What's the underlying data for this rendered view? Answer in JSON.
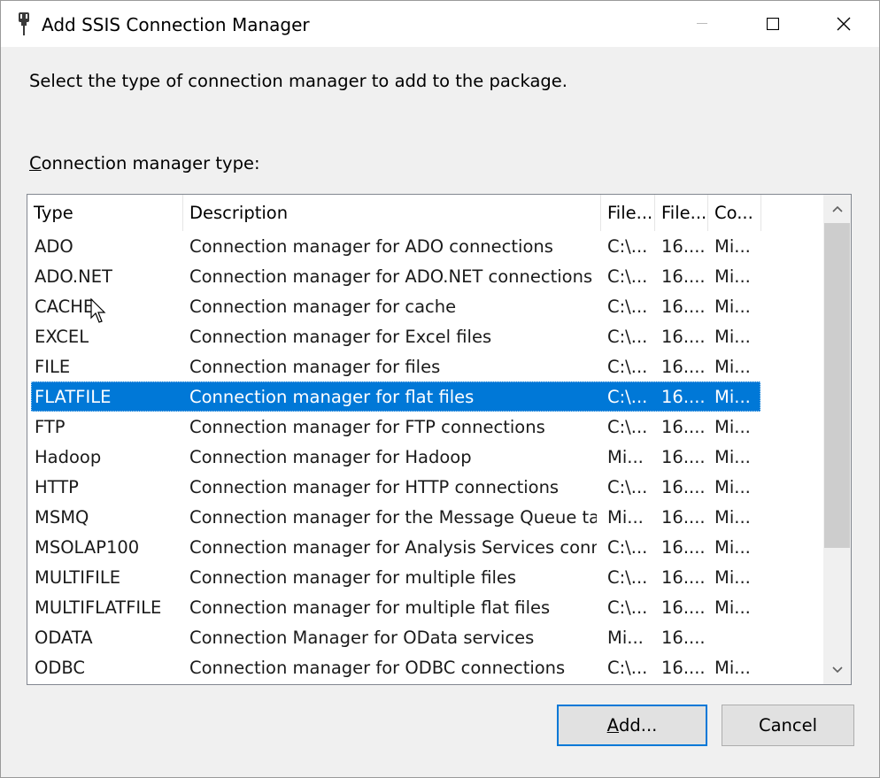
{
  "window": {
    "title": "Add SSIS Connection Manager",
    "app_icon": "ssis-plug-icon",
    "controls": [
      "minimize-icon",
      "maximize-icon",
      "close-icon"
    ]
  },
  "instruction": "Select the type of connection manager to add to the package.",
  "list_label": {
    "accel": "C",
    "rest": "onnection manager type:"
  },
  "columns": [
    "Type",
    "Description",
    "File...",
    "File...",
    "Co..."
  ],
  "rows": [
    {
      "type": "ADO",
      "description": "Connection manager for ADO connections",
      "file_name": "C:\\...",
      "file_version": "16....",
      "company": "Mi..."
    },
    {
      "type": "ADO.NET",
      "description": "Connection manager for ADO.NET connections",
      "file_name": "C:\\...",
      "file_version": "16....",
      "company": "Mi..."
    },
    {
      "type": "CACHE",
      "description": "Connection manager for cache",
      "file_name": "C:\\...",
      "file_version": "16....",
      "company": "Mi..."
    },
    {
      "type": "EXCEL",
      "description": "Connection manager for Excel files",
      "file_name": "C:\\...",
      "file_version": "16....",
      "company": "Mi..."
    },
    {
      "type": "FILE",
      "description": "Connection manager for files",
      "file_name": "C:\\...",
      "file_version": "16....",
      "company": "Mi..."
    },
    {
      "type": "FLATFILE",
      "description": "Connection manager for flat files",
      "file_name": "C:\\...",
      "file_version": "16....",
      "company": "Mi...",
      "selected": true
    },
    {
      "type": "FTP",
      "description": "Connection manager for FTP connections",
      "file_name": "C:\\...",
      "file_version": "16....",
      "company": "Mi..."
    },
    {
      "type": "Hadoop",
      "description": "Connection manager for Hadoop",
      "file_name": "Mi...",
      "file_version": "16....",
      "company": "Mi..."
    },
    {
      "type": "HTTP",
      "description": "Connection manager for HTTP connections",
      "file_name": "C:\\...",
      "file_version": "16....",
      "company": "Mi..."
    },
    {
      "type": "MSMQ",
      "description": "Connection manager for the Message Queue ta...",
      "file_name": "Mi...",
      "file_version": "16....",
      "company": "Mi..."
    },
    {
      "type": "MSOLAP100",
      "description": "Connection manager for Analysis Services conn...",
      "file_name": "C:\\...",
      "file_version": "16....",
      "company": "Mi..."
    },
    {
      "type": "MULTIFILE",
      "description": "Connection manager for multiple files",
      "file_name": "C:\\...",
      "file_version": "16....",
      "company": "Mi..."
    },
    {
      "type": "MULTIFLATFILE",
      "description": "Connection manager for multiple flat files",
      "file_name": "C:\\...",
      "file_version": "16....",
      "company": "Mi..."
    },
    {
      "type": "ODATA",
      "description": "Connection Manager for OData services",
      "file_name": "Mi...",
      "file_version": "16....",
      "company": ""
    },
    {
      "type": "ODBC",
      "description": "Connection manager for ODBC connections",
      "file_name": "C:\\...",
      "file_version": "16....",
      "company": "Mi..."
    }
  ],
  "scrollbar": {
    "position_fraction": 0.0,
    "visible_fraction": 0.75
  },
  "buttons": {
    "add": {
      "accel": "A",
      "rest": "dd..."
    },
    "cancel": "Cancel"
  },
  "colors": {
    "selection": "#0078d7",
    "default_button_border": "#0078d7"
  }
}
